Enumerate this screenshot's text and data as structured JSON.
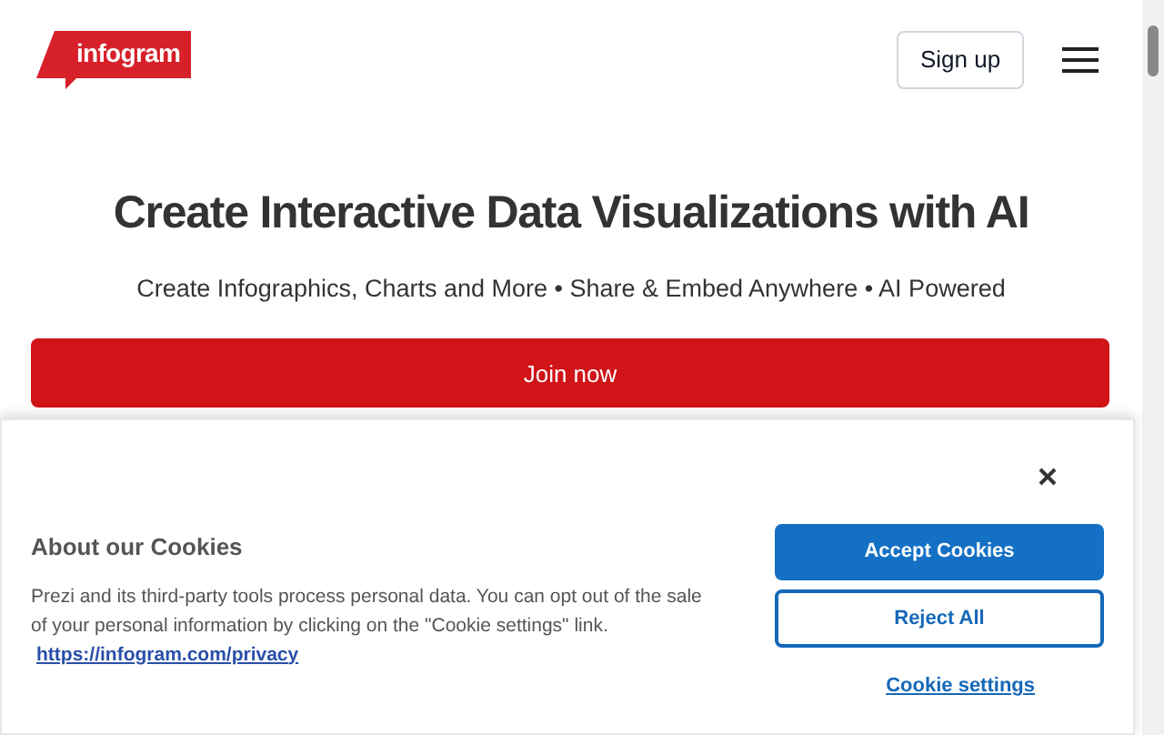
{
  "header": {
    "logo": "infogram",
    "signup": "Sign up"
  },
  "hero": {
    "title": "Create Interactive Data Visualizations with AI",
    "subtitle": "Create Infographics, Charts and More • Share & Embed Anywhere • AI Powered",
    "cta": "Join now"
  },
  "cookie_banner": {
    "title": "About our Cookies",
    "body": "Prezi and its third-party tools process personal data. You can opt out of the sale of your personal information by clicking on the \"Cookie settings\" link.",
    "link": "https://infogram.com/privacy",
    "accept": "Accept Cookies",
    "reject": "Reject All",
    "settings": "Cookie settings"
  }
}
